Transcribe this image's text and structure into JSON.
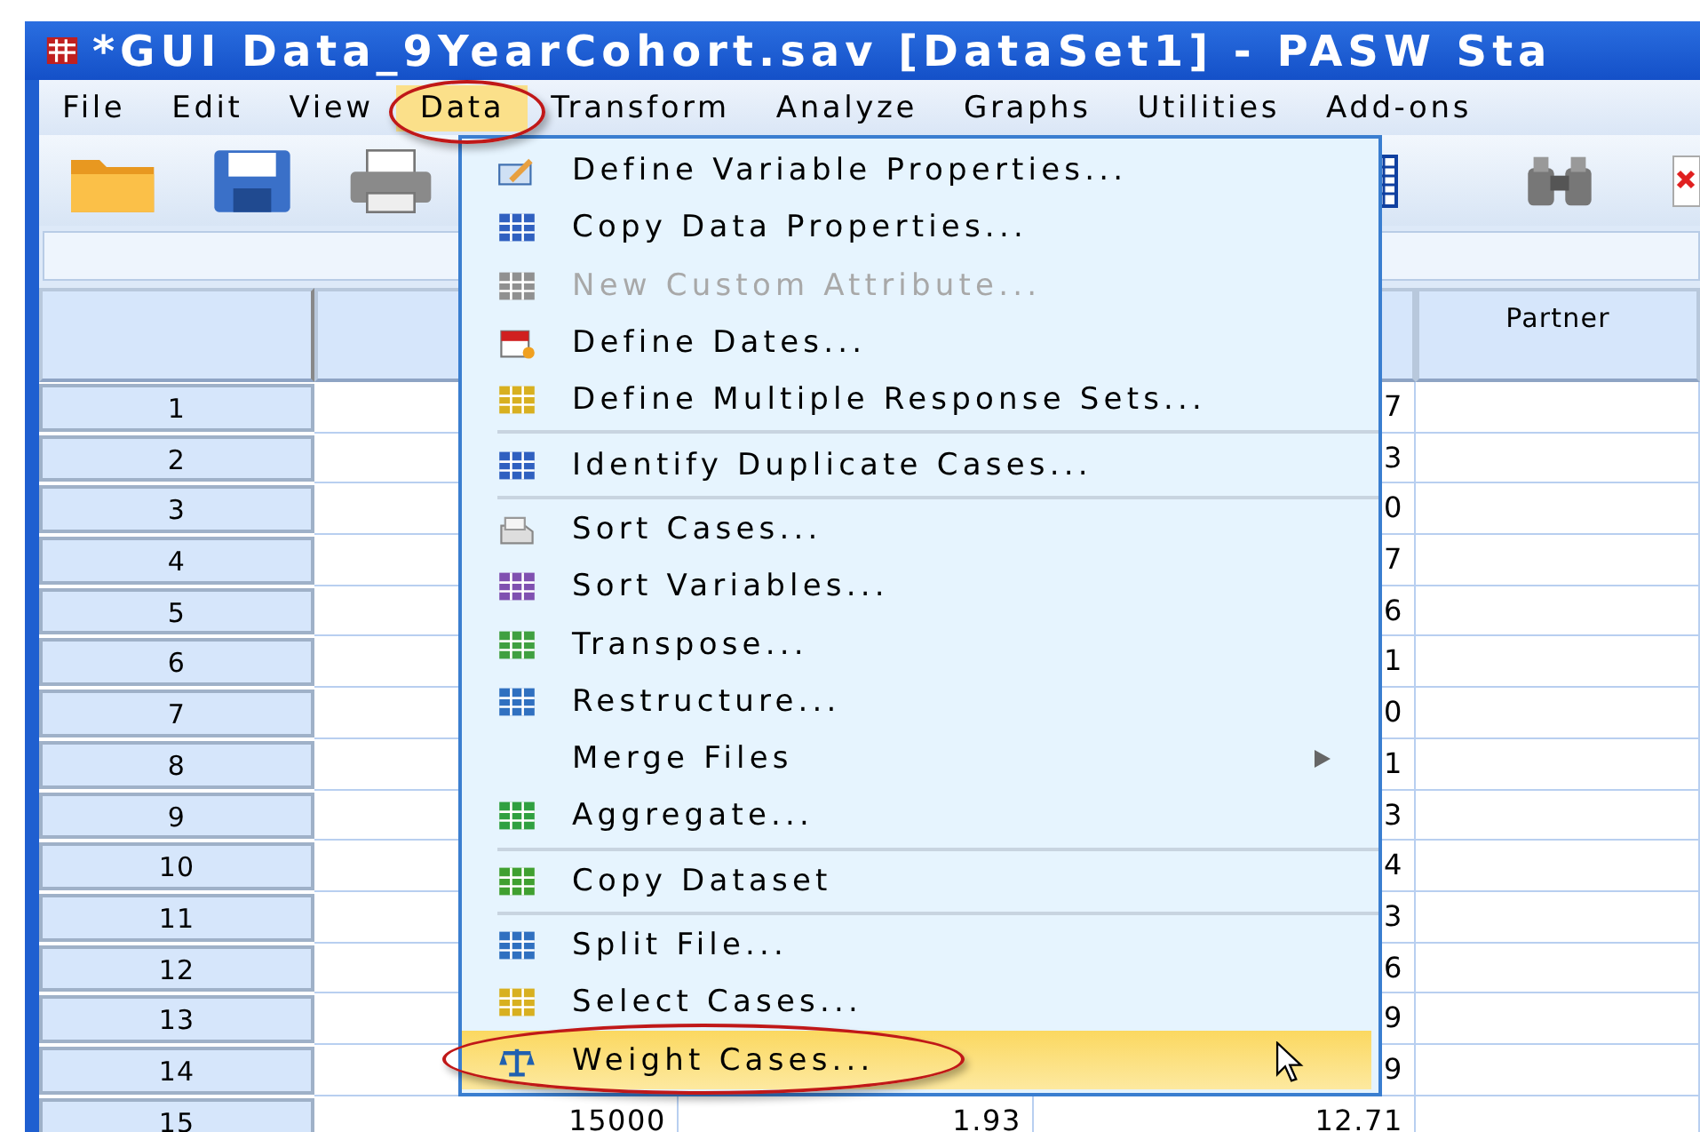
{
  "window": {
    "title": "*GUI Data_9YearCohort.sav [DataSet1] - PASW Sta"
  },
  "menu_bar": [
    {
      "label": "File",
      "selected": false
    },
    {
      "label": "Edit",
      "selected": false
    },
    {
      "label": "View",
      "selected": false
    },
    {
      "label": "Data",
      "selected": true
    },
    {
      "label": "Transform",
      "selected": false
    },
    {
      "label": "Analyze",
      "selected": false
    },
    {
      "label": "Graphs",
      "selected": false
    },
    {
      "label": "Utilities",
      "selected": false
    },
    {
      "label": "Add-ons",
      "selected": false
    }
  ],
  "data_menu": [
    {
      "kind": "item",
      "label": "Define Variable Properties...",
      "disabled": false,
      "selected": false,
      "submenu": false
    },
    {
      "kind": "item",
      "label": "Copy Data Properties...",
      "disabled": false,
      "selected": false,
      "submenu": false
    },
    {
      "kind": "item",
      "label": "New Custom Attribute...",
      "disabled": true,
      "selected": false,
      "submenu": false
    },
    {
      "kind": "item",
      "label": "Define Dates...",
      "disabled": false,
      "selected": false,
      "submenu": false
    },
    {
      "kind": "item",
      "label": "Define Multiple Response Sets...",
      "disabled": false,
      "selected": false,
      "submenu": false
    },
    {
      "kind": "separator"
    },
    {
      "kind": "item",
      "label": "Identify Duplicate Cases...",
      "disabled": false,
      "selected": false,
      "submenu": false
    },
    {
      "kind": "separator"
    },
    {
      "kind": "item",
      "label": "Sort Cases...",
      "disabled": false,
      "selected": false,
      "submenu": false
    },
    {
      "kind": "item",
      "label": "Sort Variables...",
      "disabled": false,
      "selected": false,
      "submenu": false
    },
    {
      "kind": "item",
      "label": "Transpose...",
      "disabled": false,
      "selected": false,
      "submenu": false
    },
    {
      "kind": "item",
      "label": "Restructure...",
      "disabled": false,
      "selected": false,
      "submenu": false
    },
    {
      "kind": "item",
      "label": "Merge Files",
      "disabled": false,
      "selected": false,
      "submenu": true
    },
    {
      "kind": "item",
      "label": "Aggregate...",
      "disabled": false,
      "selected": false,
      "submenu": false
    },
    {
      "kind": "separator"
    },
    {
      "kind": "item",
      "label": "Copy Dataset",
      "disabled": false,
      "selected": false,
      "submenu": false
    },
    {
      "kind": "separator"
    },
    {
      "kind": "item",
      "label": "Split File...",
      "disabled": false,
      "selected": false,
      "submenu": false
    },
    {
      "kind": "item",
      "label": "Select Cases...",
      "disabled": false,
      "selected": false,
      "submenu": false
    },
    {
      "kind": "item",
      "label": "Weight Cases...",
      "disabled": false,
      "selected": true,
      "submenu": false
    }
  ],
  "table": {
    "column_5": {
      "heading": "Partner"
    },
    "rows": [
      {
        "number": "1",
        "column_4": "7"
      },
      {
        "number": "2",
        "column_4": "3"
      },
      {
        "number": "3",
        "column_4": "0"
      },
      {
        "number": "4",
        "column_4": "7"
      },
      {
        "number": "5",
        "column_4": "6"
      },
      {
        "number": "6",
        "column_4": "1"
      },
      {
        "number": "7",
        "column_4": "0"
      },
      {
        "number": "8",
        "column_4": "1"
      },
      {
        "number": "9",
        "column_4": "3"
      },
      {
        "number": "10",
        "column_4": "4"
      },
      {
        "number": "11",
        "column_4": "3"
      },
      {
        "number": "12",
        "column_4": "6"
      },
      {
        "number": "13",
        "column_4": "9"
      },
      {
        "number": "14",
        "column_4": "9"
      },
      {
        "number": "15",
        "column_2": "15000",
        "column_3": "1.93",
        "column_4": "12.71"
      }
    ]
  }
}
